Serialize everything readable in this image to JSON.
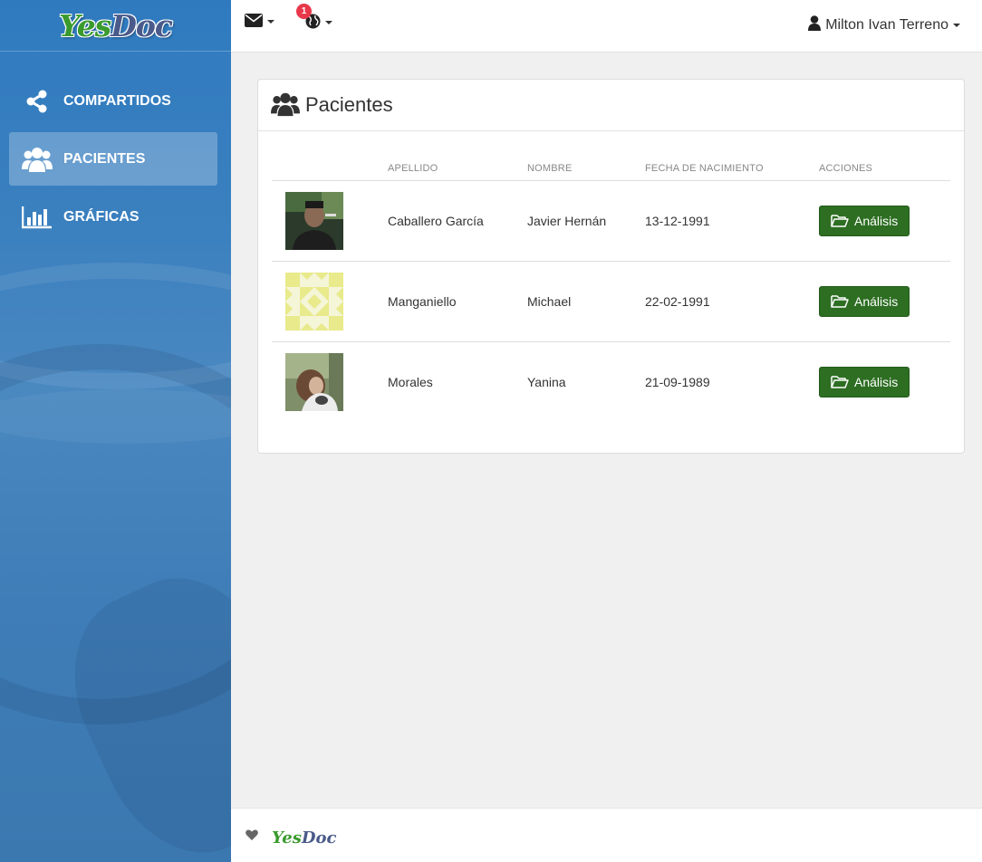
{
  "brand": {
    "yes": "Yes",
    "doc": "Doc"
  },
  "sidebar": {
    "items": [
      {
        "label": "COMPARTIDOS",
        "icon": "share-icon"
      },
      {
        "label": "PACIENTES",
        "icon": "users-icon",
        "active": true
      },
      {
        "label": "GRÁFICAS",
        "icon": "bar-chart-icon"
      }
    ]
  },
  "topbar": {
    "notification_count": "1",
    "user_name": "Milton Ivan Terreno"
  },
  "panel": {
    "title": "Pacientes",
    "columns": [
      "APELLIDO",
      "NOMBRE",
      "FECHA DE NACIMIENTO",
      "ACCIONES"
    ],
    "rows": [
      {
        "apellido": "Caballero García",
        "nombre": "Javier Hernán",
        "fecha": "13-12-1991",
        "action": "Análisis",
        "avatar": "photo"
      },
      {
        "apellido": "Manganiello",
        "nombre": "Michael",
        "fecha": "22-02-1991",
        "action": "Análisis",
        "avatar": "identicon"
      },
      {
        "apellido": "Morales",
        "nombre": "Yanina",
        "fecha": "21-09-1989",
        "action": "Análisis",
        "avatar": "photo"
      }
    ]
  },
  "footer": {
    "yes": "Yes",
    "doc": "Doc"
  },
  "colors": {
    "sidebar": "#3a80bf",
    "button": "#2d6e22",
    "badge": "#e8384a",
    "logo_green": "#3a9a2e",
    "logo_blue": "#4a5a8a"
  }
}
